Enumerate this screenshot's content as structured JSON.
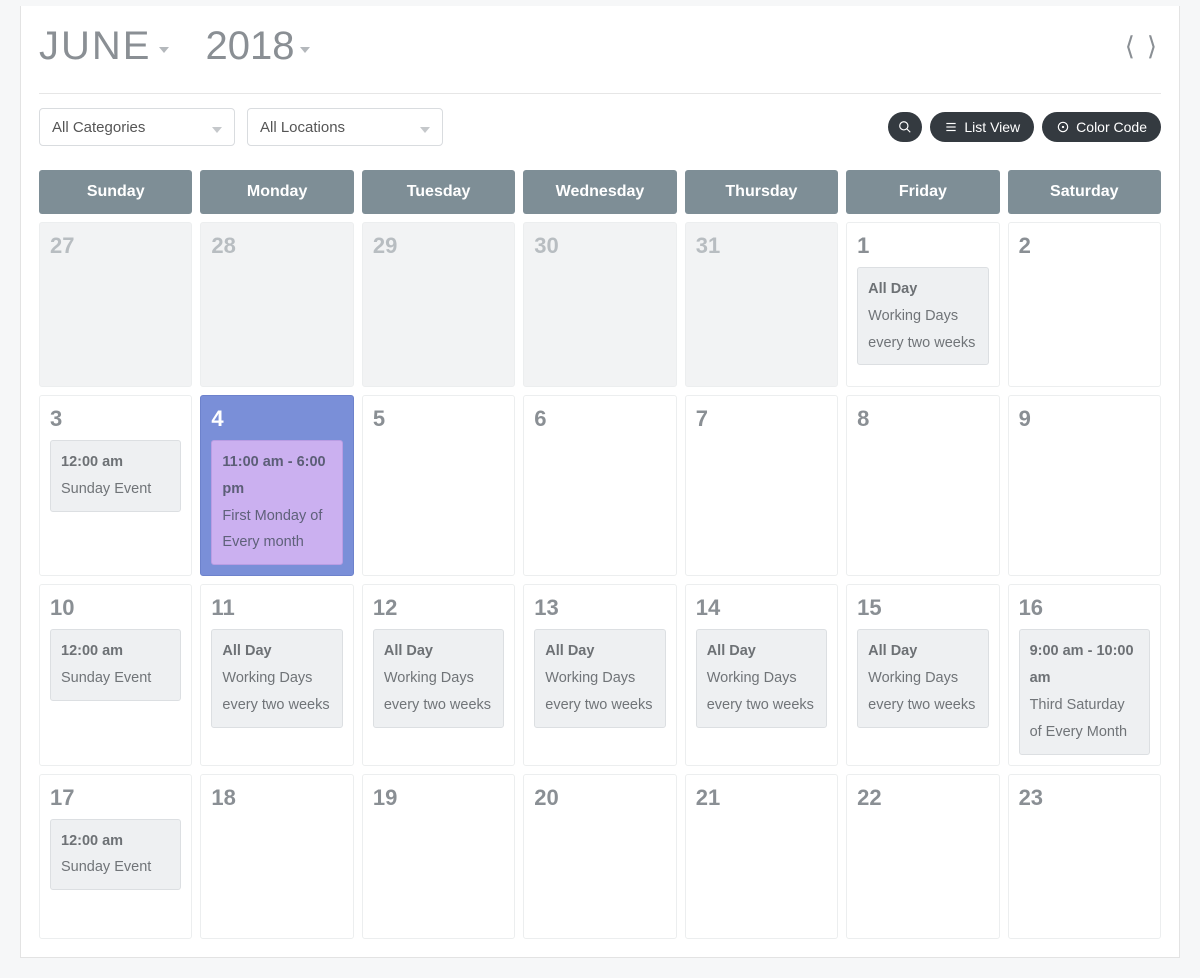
{
  "header": {
    "month": "JUNE",
    "year": "2018"
  },
  "toolbar": {
    "category_label": "All Categories",
    "location_label": "All Locations",
    "list_view_label": "List View",
    "color_code_label": "Color Code"
  },
  "day_names": [
    "Sunday",
    "Monday",
    "Tuesday",
    "Wednesday",
    "Thursday",
    "Friday",
    "Saturday"
  ],
  "weeks": [
    [
      {
        "num": "27",
        "out": true,
        "events": []
      },
      {
        "num": "28",
        "out": true,
        "events": []
      },
      {
        "num": "29",
        "out": true,
        "events": []
      },
      {
        "num": "30",
        "out": true,
        "events": []
      },
      {
        "num": "31",
        "out": true,
        "events": []
      },
      {
        "num": "1",
        "events": [
          {
            "time": "All Day",
            "title": "Working Days every two weeks"
          }
        ]
      },
      {
        "num": "2",
        "events": []
      }
    ],
    [
      {
        "num": "3",
        "events": [
          {
            "time": "12:00 am",
            "title": "Sunday Event"
          }
        ]
      },
      {
        "num": "4",
        "today": true,
        "events": [
          {
            "time": "11:00 am - 6:00 pm",
            "title": "First Monday of Every month",
            "variant": "purple"
          }
        ]
      },
      {
        "num": "5",
        "events": []
      },
      {
        "num": "6",
        "events": []
      },
      {
        "num": "7",
        "events": []
      },
      {
        "num": "8",
        "events": []
      },
      {
        "num": "9",
        "events": []
      }
    ],
    [
      {
        "num": "10",
        "events": [
          {
            "time": "12:00 am",
            "title": "Sunday Event"
          }
        ]
      },
      {
        "num": "11",
        "events": [
          {
            "time": "All Day",
            "title": "Working Days every two weeks"
          }
        ]
      },
      {
        "num": "12",
        "events": [
          {
            "time": "All Day",
            "title": "Working Days every two weeks"
          }
        ]
      },
      {
        "num": "13",
        "events": [
          {
            "time": "All Day",
            "title": "Working Days every two weeks"
          }
        ]
      },
      {
        "num": "14",
        "events": [
          {
            "time": "All Day",
            "title": "Working Days every two weeks"
          }
        ]
      },
      {
        "num": "15",
        "events": [
          {
            "time": "All Day",
            "title": "Working Days every two weeks"
          }
        ]
      },
      {
        "num": "16",
        "events": [
          {
            "time": "9:00 am - 10:00 am",
            "title": "Third Saturday of Every Month"
          }
        ]
      }
    ],
    [
      {
        "num": "17",
        "events": [
          {
            "time": "12:00 am",
            "title": "Sunday Event"
          }
        ]
      },
      {
        "num": "18",
        "events": []
      },
      {
        "num": "19",
        "events": []
      },
      {
        "num": "20",
        "events": []
      },
      {
        "num": "21",
        "events": []
      },
      {
        "num": "22",
        "events": []
      },
      {
        "num": "23",
        "events": []
      }
    ]
  ]
}
